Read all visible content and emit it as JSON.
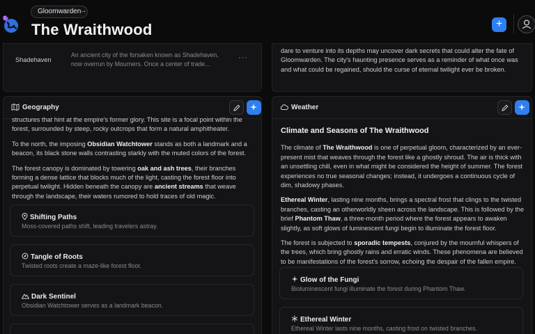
{
  "header": {
    "breadcrumb": "Gloomwarden",
    "breadcrumb_arrow": "→",
    "title": "The Wraithwood",
    "add_label": "+"
  },
  "locations_row": {
    "name": "Shadehaven",
    "description": "An ancient city of the forsaken known as Shadehaven, now overrun by Mourners. Once a center of trade...",
    "more": "···"
  },
  "top_right_text": "dare to venture into its depths may uncover dark secrets that could alter the fate of Gloomwarden. The city's haunting presence serves as a reminder of what once was and what could be regained, should the curse of eternal twilight ever be broken.",
  "geography": {
    "title": "Geography",
    "p1": "structures that hint at the empire's former glory. This site is a focal point within the forest, surrounded by steep, rocky outcrops that form a natural amphitheater.",
    "p2_a": "To the north, the imposing ",
    "p2_b": "Obsidian Watchtower",
    "p2_c": " stands as both a landmark and a beacon, its black stone walls contrasting starkly with the muted colors of the forest.",
    "p3_a": "The forest canopy is dominated by towering ",
    "p3_b": "oak and ash trees",
    "p3_c": ", their branches forming a dense lattice that blocks much of the light, casting the forest floor into perpetual twilight. Hidden beneath the canopy are ",
    "p3_d": "ancient streams",
    "p3_e": " that weave through the landscape, their waters rumored to hold traces of old magic.",
    "cards": [
      {
        "title": "Shifting Paths",
        "desc": "Moss-covered paths shift, leading travelers astray.",
        "icon": "map-pin-icon"
      },
      {
        "title": "Tangle of Roots",
        "desc": "Twisted roots create a maze-like forest floor.",
        "icon": "compass-icon"
      },
      {
        "title": "Dark Sentinel",
        "desc": "Obsidian Watchtower serves as a landmark beacon.",
        "icon": "mountain-icon"
      }
    ]
  },
  "weather": {
    "title": "Weather",
    "heading": "Climate and Seasons of The Wraithwood",
    "p1_a": "The climate of ",
    "p1_b": "The Wraithwood",
    "p1_c": " is one of perpetual gloom, characterized by an ever-present mist that weaves through the forest like a ghostly shroud. The air is thick with an unsettling chill, even in what might be considered the height of summer. The forest experiences no true seasonal changes; instead, it undergoes a continuous cycle of dim, shadowy phases.",
    "p2_a": "Ethereal Winter",
    "p2_b": ", lasting nine months, brings a spectral frost that clings to the twisted branches, casting an otherworldly sheen across the landscape. This is followed by the brief ",
    "p2_c": "Phantom Thaw",
    "p2_d": ", a three-month period where the forest appears to awaken slightly, as soft glows of luminescent fungi begin to illuminate the forest floor.",
    "p3_a": "The forest is subjected to ",
    "p3_b": "sporadic tempests",
    "p3_c": ", conjured by the mournful whispers of the trees, which bring ghostly rains and erratic winds. These phenomena are believed to be manifestations of the forest's sorrow, echoing the despair of the fallen empire.",
    "cards": [
      {
        "title": "Glow of the Fungi",
        "desc": "Bioluminescent fungi illuminate the forest during Phantom Thaw.",
        "icon": "sparkle-icon"
      },
      {
        "title": "Ethereal Winter",
        "desc": "Ethereal Winter lasts nine months, casting frost on twisted branches.",
        "icon": "snowflake-icon"
      }
    ]
  },
  "colors": {
    "background": "#0b0b0c",
    "panel": "#141416",
    "accent": "#2f7ff0",
    "text": "#cfcfd2",
    "muted": "#8a8a90"
  }
}
